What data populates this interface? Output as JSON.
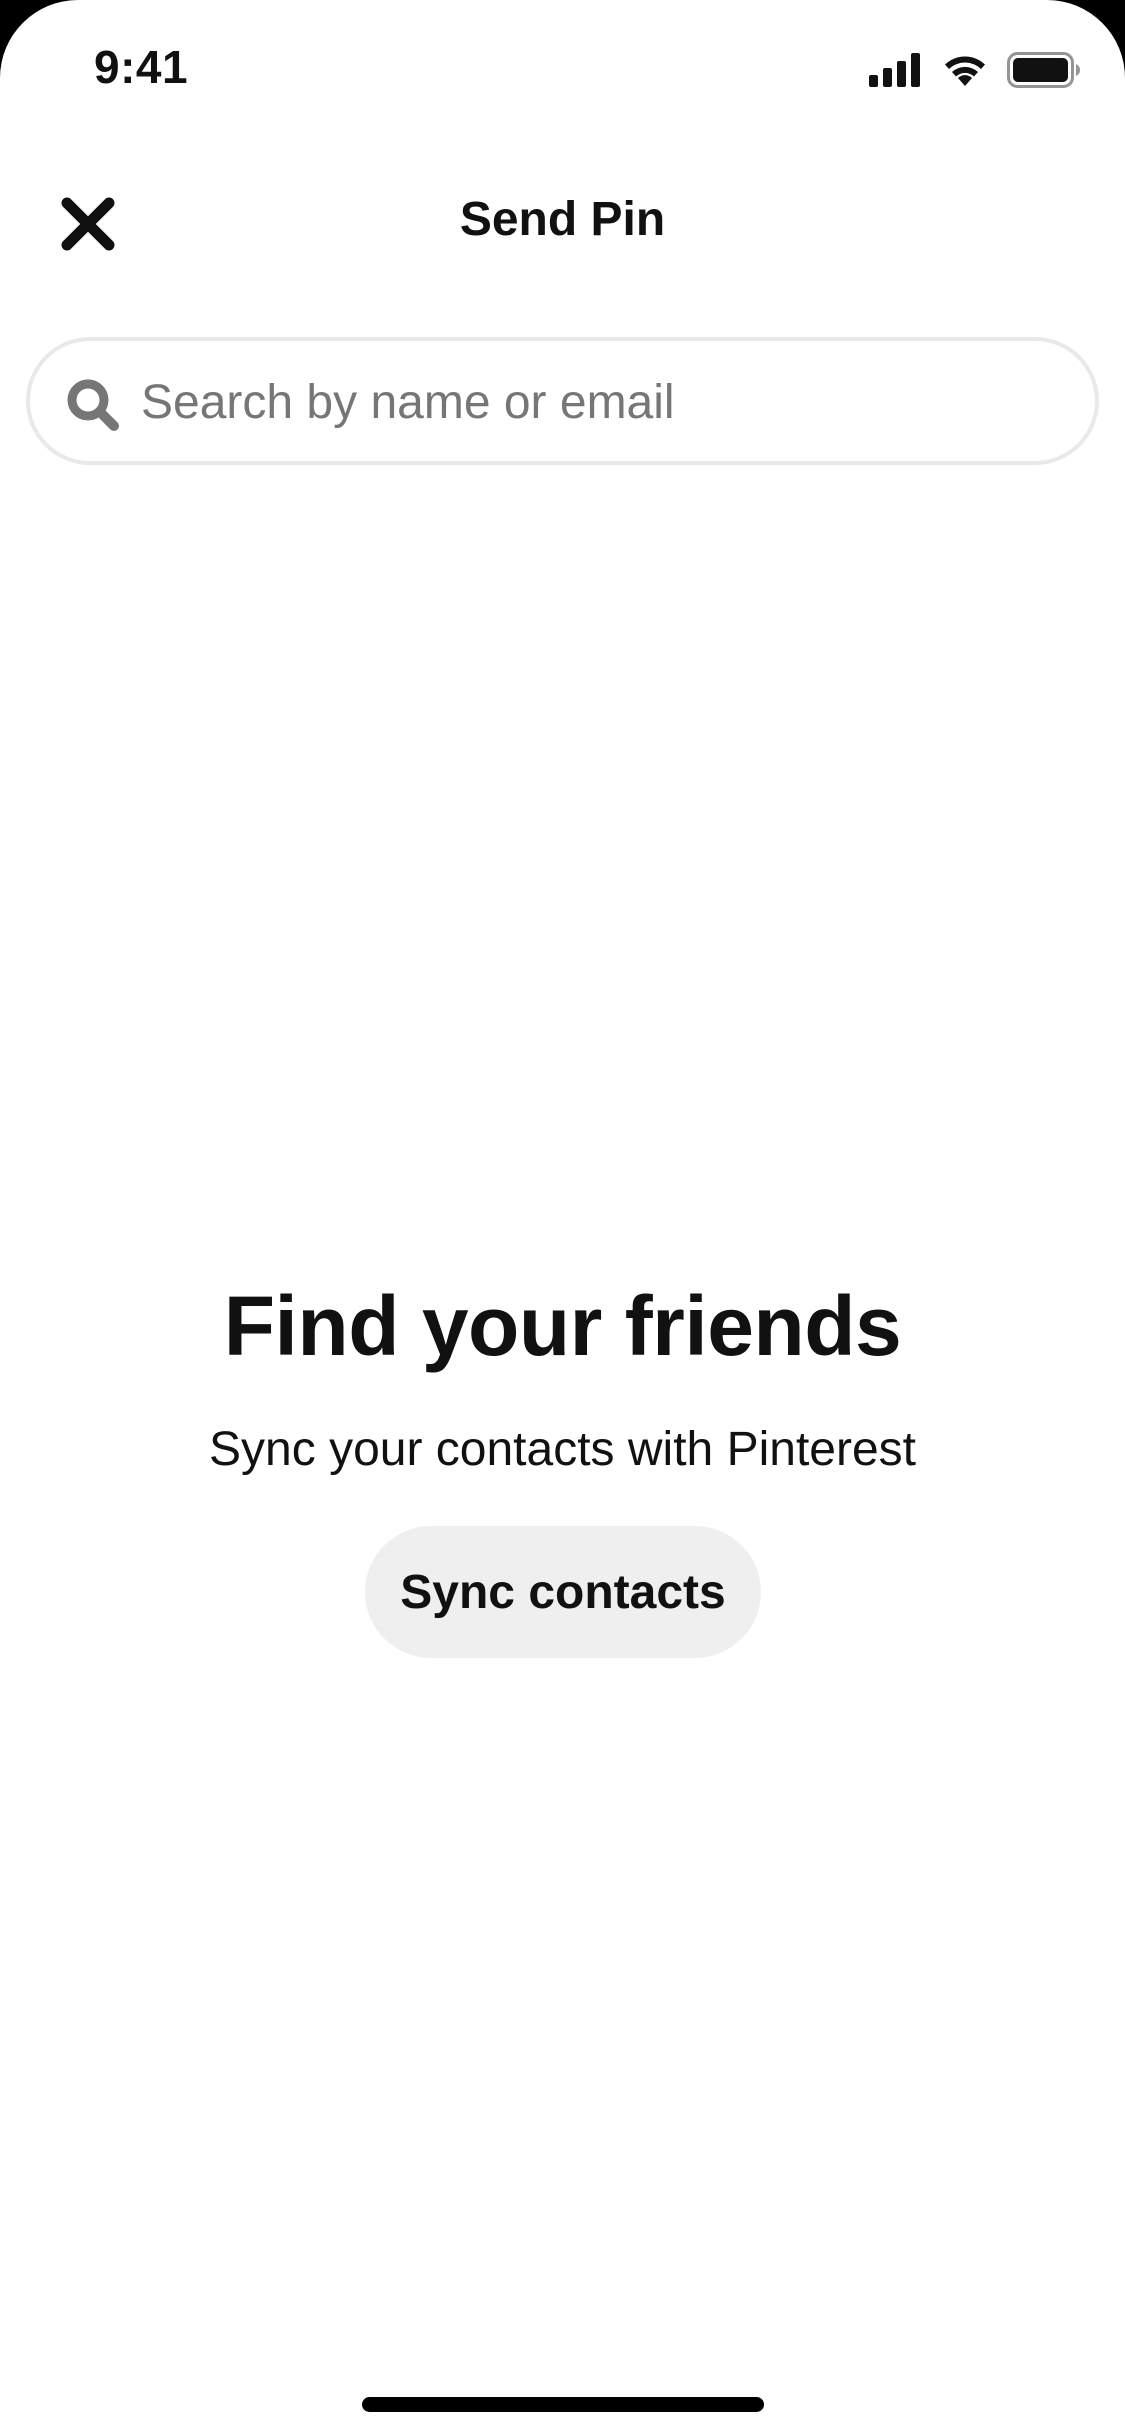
{
  "status_bar": {
    "time": "9:41",
    "icons": [
      "cellular-signal-icon",
      "wifi-icon",
      "battery-icon"
    ]
  },
  "header": {
    "title": "Send Pin",
    "close_icon": "close-icon"
  },
  "search": {
    "placeholder": "Search by name or email",
    "value": "",
    "icon": "search-icon"
  },
  "empty_state": {
    "title": "Find your friends",
    "subtitle": "Sync your contacts with Pinterest",
    "button_label": "Sync contacts"
  },
  "colors": {
    "text": "#111111",
    "placeholder": "#767676",
    "search_border": "#e9e9e9",
    "button_bg": "#efefef",
    "background": "#ffffff"
  }
}
